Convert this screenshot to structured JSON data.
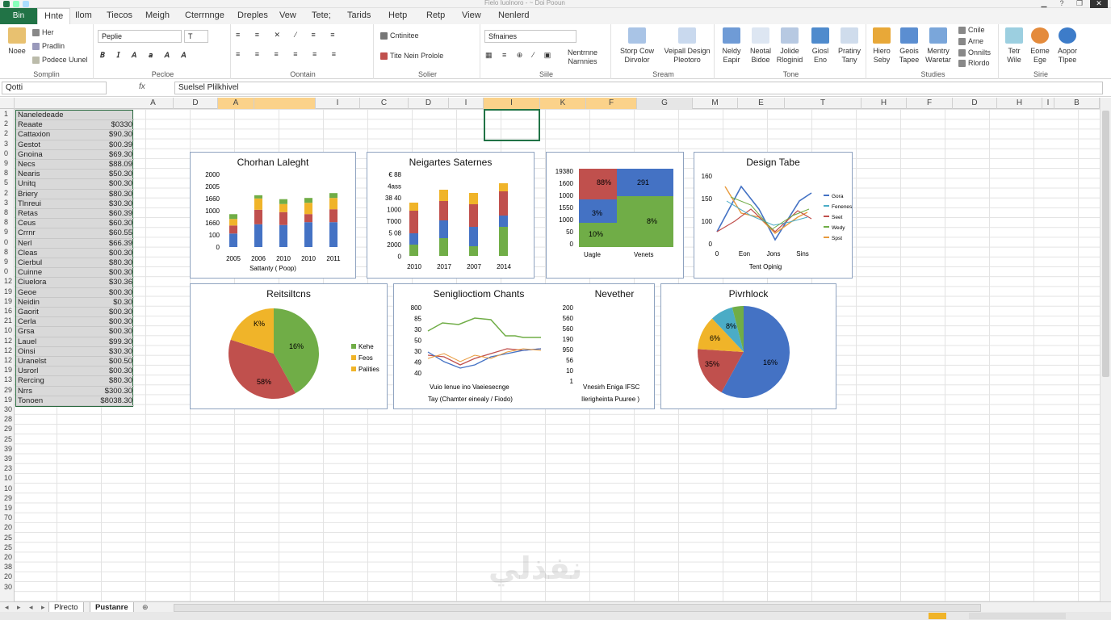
{
  "title_bar": {
    "title": "Fielo Iuolnoro - ~ Doi Pooun"
  },
  "tabs": {
    "file": "Bin",
    "home": "Hnte",
    "items": [
      "Ilom",
      "Tiecos",
      "Meigh",
      "Cterrnnge",
      "Dreples",
      "Vew",
      "Tete;",
      "Tarids",
      "Hetp",
      "Retp",
      "View",
      "Nenlerd"
    ]
  },
  "ribbon": {
    "clipboard": {
      "big": "Noee",
      "items": [
        "Her",
        "Pradlin",
        "Podece Uunel"
      ],
      "label": "Somplin"
    },
    "font": {
      "font_name": "Peplie",
      "font_size": "T",
      "label": "Pecloe"
    },
    "align": {
      "label": "Oontain"
    },
    "number": {
      "items": [
        "Cntinitee",
        "Tite Nein Prolole"
      ],
      "label": "Solier"
    },
    "styles": {
      "combo": "Sfnaines",
      "items": [
        "Nentrnne",
        "Narnnies"
      ],
      "label": "Siile"
    },
    "cells": {
      "big": [
        "Storp Cow",
        "Dirvolor",
        "Veipall Design",
        "Pleotoro"
      ],
      "label": "Sream"
    },
    "tone": {
      "big": [
        "Neldy",
        "Eapir",
        "Neotal",
        "Bidoe",
        "Jolide",
        "Rloginid",
        "Giosl",
        "Eno",
        "Pratiny",
        "Tany"
      ],
      "label": "Tone"
    },
    "studies": {
      "big": [
        "Hiero",
        "Seby",
        "Geois",
        "Tapee",
        "Mentry",
        "Waretar"
      ],
      "small": [
        "Cnile",
        "Arne",
        "Onnilts",
        "Rlordo"
      ],
      "label": "Studies"
    },
    "sine": {
      "big": [
        "Tetr",
        "Wile",
        "Eome",
        "Ege",
        "Aopor",
        "Tlpee"
      ],
      "label": "Sirie"
    }
  },
  "formula_bar": {
    "name_box": "Qotti",
    "fx": "fx",
    "content": "Suelsel Plilkhivel"
  },
  "columns": [
    "A",
    "D",
    "A",
    "",
    "I",
    "C",
    "D",
    "I",
    "I",
    "K",
    "F",
    "G",
    "M",
    "E",
    "T",
    "H",
    "F",
    "D",
    "H",
    "I",
    "B"
  ],
  "rows": [
    "1",
    "2",
    "2",
    "3",
    "0",
    "9",
    "8",
    "5",
    "2",
    "3",
    "8",
    "8",
    "9",
    "0",
    "8",
    "9",
    "0",
    "12",
    "19",
    "19",
    "16",
    "21",
    "10",
    "12",
    "12",
    "12",
    "19",
    "13",
    "29",
    "19",
    "30",
    "28",
    "29",
    "25",
    "39",
    "39",
    "23",
    "10",
    "10",
    "29",
    "19",
    "70",
    "20",
    "25",
    "25",
    "20",
    "38",
    "20",
    "30"
  ],
  "table": {
    "header": "Naneledeade",
    "rows": [
      {
        "name": "Reaate",
        "value": "$0330"
      },
      {
        "name": "Cattaxion",
        "value": "$90.30"
      },
      {
        "name": "Gestot",
        "value": "$00.39"
      },
      {
        "name": "Gnoina",
        "value": "$69.30"
      },
      {
        "name": "Necs",
        "value": "$88.09"
      },
      {
        "name": "Nearis",
        "value": "$50.30"
      },
      {
        "name": "Unitq",
        "value": "$00.30"
      },
      {
        "name": "Briery",
        "value": "$80.30"
      },
      {
        "name": "Tlnreui",
        "value": "$30.30"
      },
      {
        "name": "Retas",
        "value": "$60.39"
      },
      {
        "name": "Ceus",
        "value": "$60.30"
      },
      {
        "name": "Crrnr",
        "value": "$60.55"
      },
      {
        "name": "Nerl",
        "value": "$66.39"
      },
      {
        "name": "Cleas",
        "value": "$00.30"
      },
      {
        "name": "Cierbul",
        "value": "$80.30"
      },
      {
        "name": "Cuinne",
        "value": "$00.30"
      },
      {
        "name": "Ciuelora",
        "value": "$30.36"
      },
      {
        "name": "Geoe",
        "value": "$00.30"
      },
      {
        "name": "Neidin",
        "value": "$0.30"
      },
      {
        "name": "Gaorit",
        "value": "$00.30"
      },
      {
        "name": "Cerla",
        "value": "$00.30"
      },
      {
        "name": "Grsa",
        "value": "$00.30"
      },
      {
        "name": "Lauel",
        "value": "$99.30"
      },
      {
        "name": "Oinsi",
        "value": "$30.30"
      },
      {
        "name": "Uranelst",
        "value": "$00.50"
      },
      {
        "name": "Usrorl",
        "value": "$00.30"
      },
      {
        "name": "Rercing",
        "value": "$80.30"
      },
      {
        "name": "Nrrs",
        "value": "$300.30"
      },
      {
        "name": "Tonoen",
        "value": "$8038.30"
      }
    ]
  },
  "charts": {
    "c1": {
      "title": "Chorhan Laleght",
      "xlabel": "Sattanty ( Poop)",
      "yticks": [
        "2000",
        "2005",
        "1660",
        "1000",
        "1660",
        "100",
        "0"
      ],
      "xticks": [
        "2005",
        "2006",
        "2010",
        "2010",
        "2011"
      ]
    },
    "c2": {
      "title": "Neigartes Saternes",
      "yticks": [
        "€ 88",
        "4ass",
        "38 40",
        "1000",
        "T000",
        "5 08",
        "2000",
        "0"
      ],
      "xticks": [
        "2010",
        "2017",
        "2007",
        "2014"
      ]
    },
    "c3": {
      "yticks": [
        "19380",
        "1600",
        "1000",
        "1550",
        "1000",
        "50",
        "0"
      ],
      "labels": [
        "88%",
        "291",
        "3%",
        "10%",
        "8%"
      ],
      "xticks": [
        "Uagle",
        "Venets"
      ]
    },
    "c4": {
      "title": "Design Tabe",
      "yticks": [
        "160",
        "150",
        "100",
        "0"
      ],
      "xticks": [
        "0",
        "Eon",
        "Jons",
        "Sins"
      ],
      "xlabel": "Tent Opinig",
      "legend": [
        "Gora",
        "Fenenes",
        "Seet",
        "Wedy",
        "Spst"
      ]
    },
    "c5": {
      "title": "Reitsiltcns",
      "labels": [
        "K%",
        "16%",
        "58%"
      ],
      "legend": [
        "Kehe",
        "Feos",
        "Palities"
      ]
    },
    "c6": {
      "title": "Seniglioctiom Chants",
      "subtitle": "Nevether",
      "yticks": [
        "800",
        "85",
        "30",
        "50",
        "30",
        "49",
        "40"
      ],
      "yticks2": [
        "200",
        "560",
        "560",
        "190",
        "950",
        "56",
        "10",
        "1"
      ],
      "xlabel": "Vuio Ienue ino Vaeiesecnge",
      "xlabel2": "Vnesirh Eniga IFSC",
      "xnote": "Tay (Chamter einealy / Fiodo)",
      "xnote2": "Ilerigheinta Puuree )"
    },
    "c7": {
      "title": "Pivrhlock",
      "labels": [
        "8%",
        "6%",
        "35%",
        "16%"
      ]
    }
  },
  "sheets": [
    "Plrecto",
    "Pustanre"
  ],
  "watermark": "نفذلي",
  "colors": {
    "green": "#217346",
    "blue": "#4472c4",
    "red": "#c0504d",
    "orange": "#f0b429",
    "lgreen": "#70ad47",
    "teal": "#4bacc6"
  }
}
